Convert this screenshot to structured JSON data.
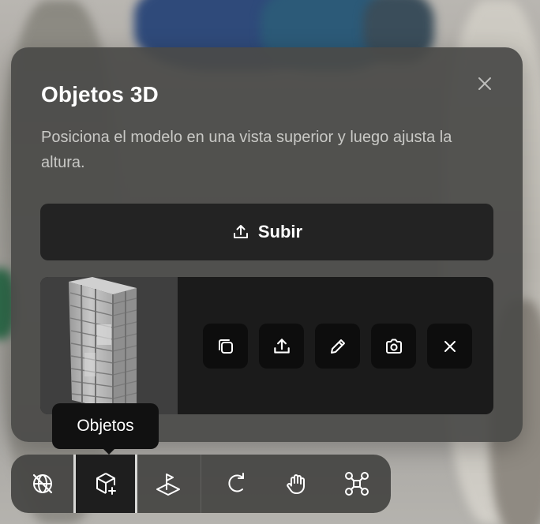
{
  "panel": {
    "title": "Objetos 3D",
    "description": "Posiciona el modelo en una vista superior y luego ajusta la altura.",
    "upload_label": "Subir"
  },
  "model_card": {
    "actions": [
      "duplicate-icon",
      "upload-icon",
      "edit-pencil-icon",
      "camera-icon",
      "close-icon"
    ]
  },
  "tooltip": {
    "text": "Objetos"
  },
  "toolbar": {
    "tools": [
      "globe-off-icon",
      "cube-add-icon",
      "flag-plane-icon",
      "rotate-icon",
      "hand-icon",
      "drone-icon"
    ],
    "active": "cube-add-icon"
  },
  "colors": {
    "panel": "#4a4a48",
    "button": "#232323",
    "card": "#1b1b1b",
    "tooltip": "#111111"
  }
}
